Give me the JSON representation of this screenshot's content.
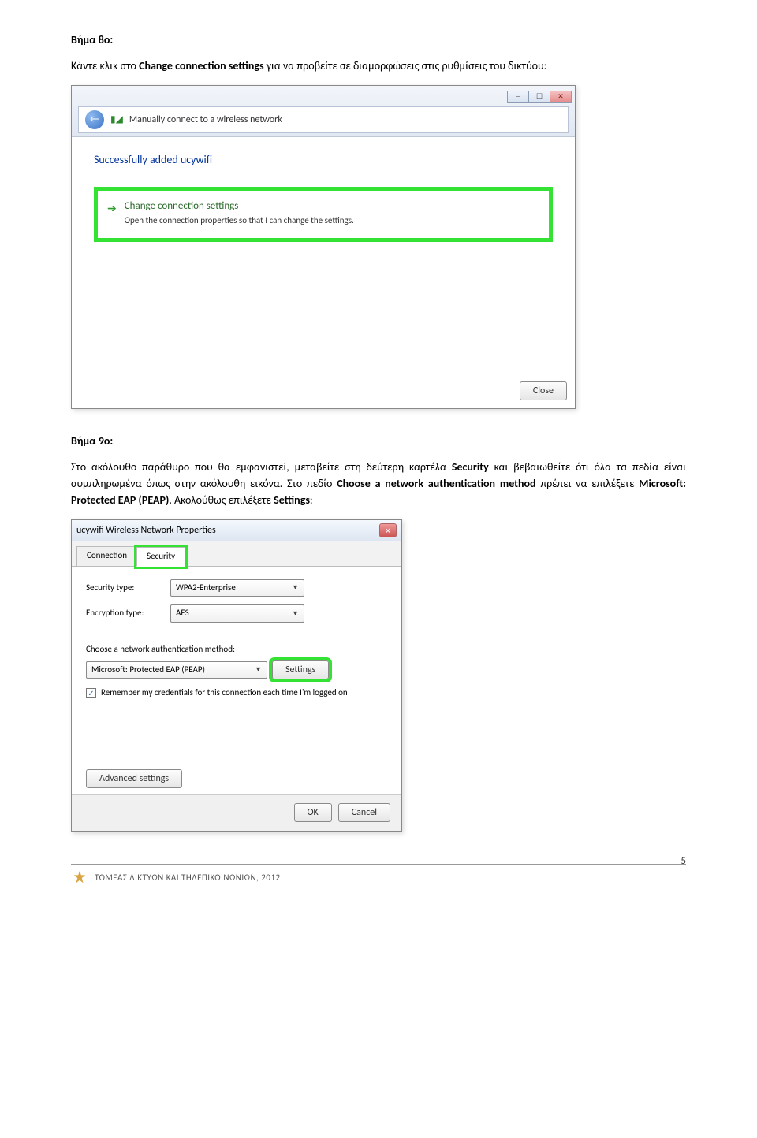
{
  "step8": {
    "heading": "Βήμα 8ο:",
    "text_pre": "Κάντε κλικ στο ",
    "text_bold": "Change connection settings",
    "text_post": " για να προβείτε σε διαμορφώσεις στις ρυθμίσεις του δικτύου:"
  },
  "win1": {
    "title": "Manually connect to a wireless network",
    "success": "Successfully added ucywifi",
    "change_title": "Change connection settings",
    "change_sub": "Open the connection properties so that I can change the settings.",
    "close": "Close"
  },
  "step9": {
    "heading": "Βήμα 9ο:",
    "t1": "Στο ακόλουθο παράθυρο που θα εμφανιστεί, μεταβείτε στη δεύτερη καρτέλα ",
    "b1": "Security",
    "t2": " και βεβαιωθείτε ότι όλα τα πεδία είναι συμπληρωμένα όπως στην ακόλουθη εικόνα. Στο πεδίο ",
    "b2": "Choose a network authentication method",
    "t3": " πρέπει να επιλέξετε ",
    "b3": "Microsoft: Protected EAP (PEAP)",
    "t4": ". Ακολούθως επιλέξετε ",
    "b4": "Settings",
    "t5": ":"
  },
  "win2": {
    "title": "ucywifi Wireless Network Properties",
    "tab_connection": "Connection",
    "tab_security": "Security",
    "sec_type_label": "Security type:",
    "sec_type_value": "WPA2-Enterprise",
    "enc_type_label": "Encryption type:",
    "enc_type_value": "AES",
    "auth_label": "Choose a network authentication method:",
    "auth_value": "Microsoft: Protected EAP (PEAP)",
    "settings_btn": "Settings",
    "remember": "Remember my credentials for this connection each time I'm logged on",
    "advanced": "Advanced settings",
    "ok": "OK",
    "cancel": "Cancel"
  },
  "footer": {
    "text": "ΤΟΜΕΑΣ ΔΙΚΤΥΩΝ ΚΑΙ ΤΗΛΕΠΙΚΟΙΝΩΝΙΩΝ, 2012",
    "page": "5"
  }
}
